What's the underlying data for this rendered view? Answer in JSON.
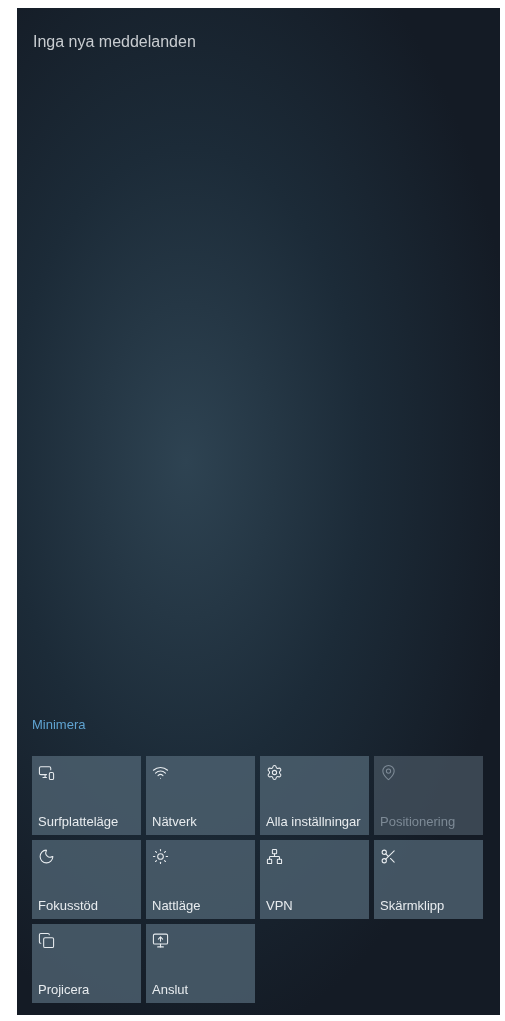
{
  "header": {
    "title": "Inga nya meddelanden"
  },
  "collapse_link": "Minimera",
  "quick_actions": [
    {
      "label": "Surfplatteläge",
      "disabled": false
    },
    {
      "label": "Nätverk",
      "disabled": false
    },
    {
      "label": "Alla inställningar",
      "disabled": false
    },
    {
      "label": "Positionering",
      "disabled": true
    },
    {
      "label": "Fokusstöd",
      "disabled": false
    },
    {
      "label": "Nattläge",
      "disabled": false
    },
    {
      "label": "VPN",
      "disabled": false
    },
    {
      "label": "Skärmklipp",
      "disabled": false
    },
    {
      "label": "Projicera",
      "disabled": false
    },
    {
      "label": "Anslut",
      "disabled": false
    }
  ]
}
